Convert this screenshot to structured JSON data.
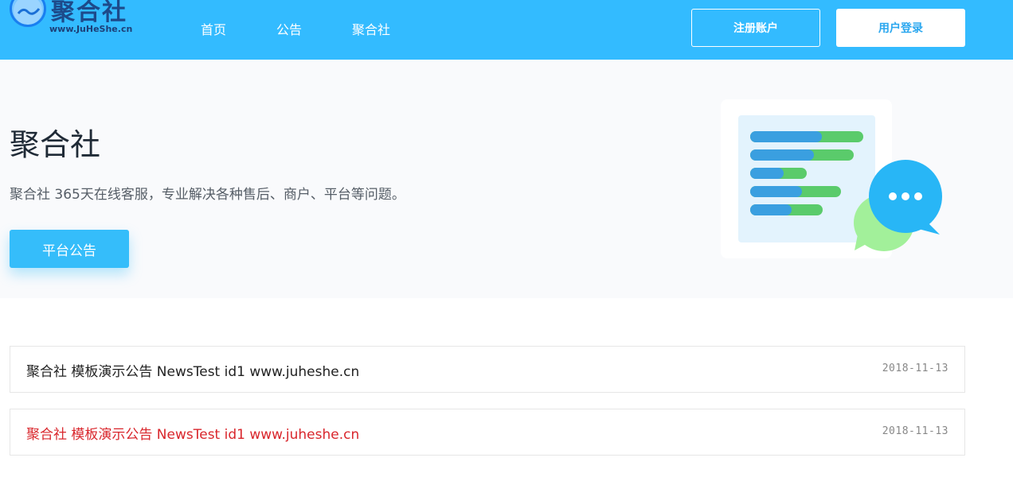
{
  "header": {
    "brand": {
      "name": "聚合社",
      "url": "www.JuHeShe.cn"
    },
    "nav": [
      {
        "label": "首页"
      },
      {
        "label": "公告"
      },
      {
        "label": "聚合社"
      }
    ],
    "register_label": "注册账户",
    "login_label": "用户登录",
    "bg_color": "#33bbff"
  },
  "hero": {
    "title": "聚合社",
    "description": "聚合社 365天在线客服，专业解决各种售后、商户、平台等问题。",
    "button_label": "平台公告",
    "illustration_icon": "chat-document-illustration"
  },
  "news": [
    {
      "title": "聚合社 模板演示公告 NewsTest id1 www.juheshe.cn",
      "date": "2018-11-13",
      "color": "#222222"
    },
    {
      "title": "聚合社 模板演示公告 NewsTest id1 www.juheshe.cn",
      "date": "2018-11-13",
      "color": "#d9262c"
    }
  ]
}
